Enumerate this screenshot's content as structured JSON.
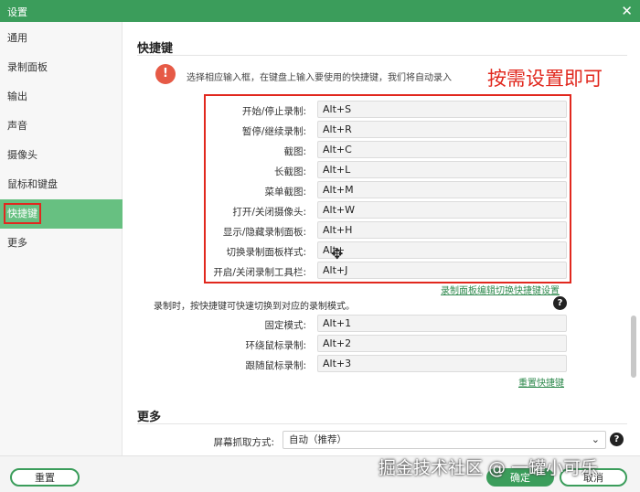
{
  "window": {
    "title": "设置",
    "close_glyph": "✕"
  },
  "sidebar": {
    "items": [
      {
        "label": "通用"
      },
      {
        "label": "录制面板"
      },
      {
        "label": "输出"
      },
      {
        "label": "声音"
      },
      {
        "label": "摄像头"
      },
      {
        "label": "鼠标和键盘"
      },
      {
        "label": "快捷键",
        "active": true
      },
      {
        "label": "更多"
      }
    ]
  },
  "hotkeys": {
    "section_title": "快捷键",
    "hint": "选择相应输入框，在键盘上输入要使用的快捷键，我们将自动录入",
    "annotation": "按需设置即可",
    "rows": [
      {
        "label": "开始/停止录制:",
        "value": "Alt+S"
      },
      {
        "label": "暂停/继续录制:",
        "value": "Alt+R"
      },
      {
        "label": "截图:",
        "value": "Alt+C"
      },
      {
        "label": "长截图:",
        "value": "Alt+L"
      },
      {
        "label": "菜单截图:",
        "value": "Alt+M"
      },
      {
        "label": "打开/关闭摄像头:",
        "value": "Alt+W"
      },
      {
        "label": "显示/隐藏录制面板:",
        "value": "Alt+H"
      },
      {
        "label": "切换录制面板样式:",
        "value": "Alt+"
      },
      {
        "label": "开启/关闭录制工具栏:",
        "value": "Alt+J"
      }
    ],
    "link_panel": "录制面板编辑切换快捷键设置",
    "mode_desc": "录制时，按快捷键可快速切换到对应的录制模式。",
    "mode_rows": [
      {
        "label": "固定模式:",
        "value": "Alt+1"
      },
      {
        "label": "环绕鼠标录制:",
        "value": "Alt+2"
      },
      {
        "label": "跟随鼠标录制:",
        "value": "Alt+3"
      }
    ],
    "reset_link": "重置快捷键"
  },
  "more": {
    "section_title": "更多",
    "capture_label": "屏幕抓取方式:",
    "capture_value": "自动（推荐）"
  },
  "footer": {
    "reset": "重置",
    "ok": "确定",
    "cancel": "取消",
    "watermark": "掘金技术社区 @ 一罐小可乐"
  },
  "icons": {
    "warning": "exclamation-icon",
    "help": "question-icon"
  },
  "colors": {
    "brand": "#3b9d5b",
    "active": "#67c081",
    "annotation": "#e1281e"
  }
}
